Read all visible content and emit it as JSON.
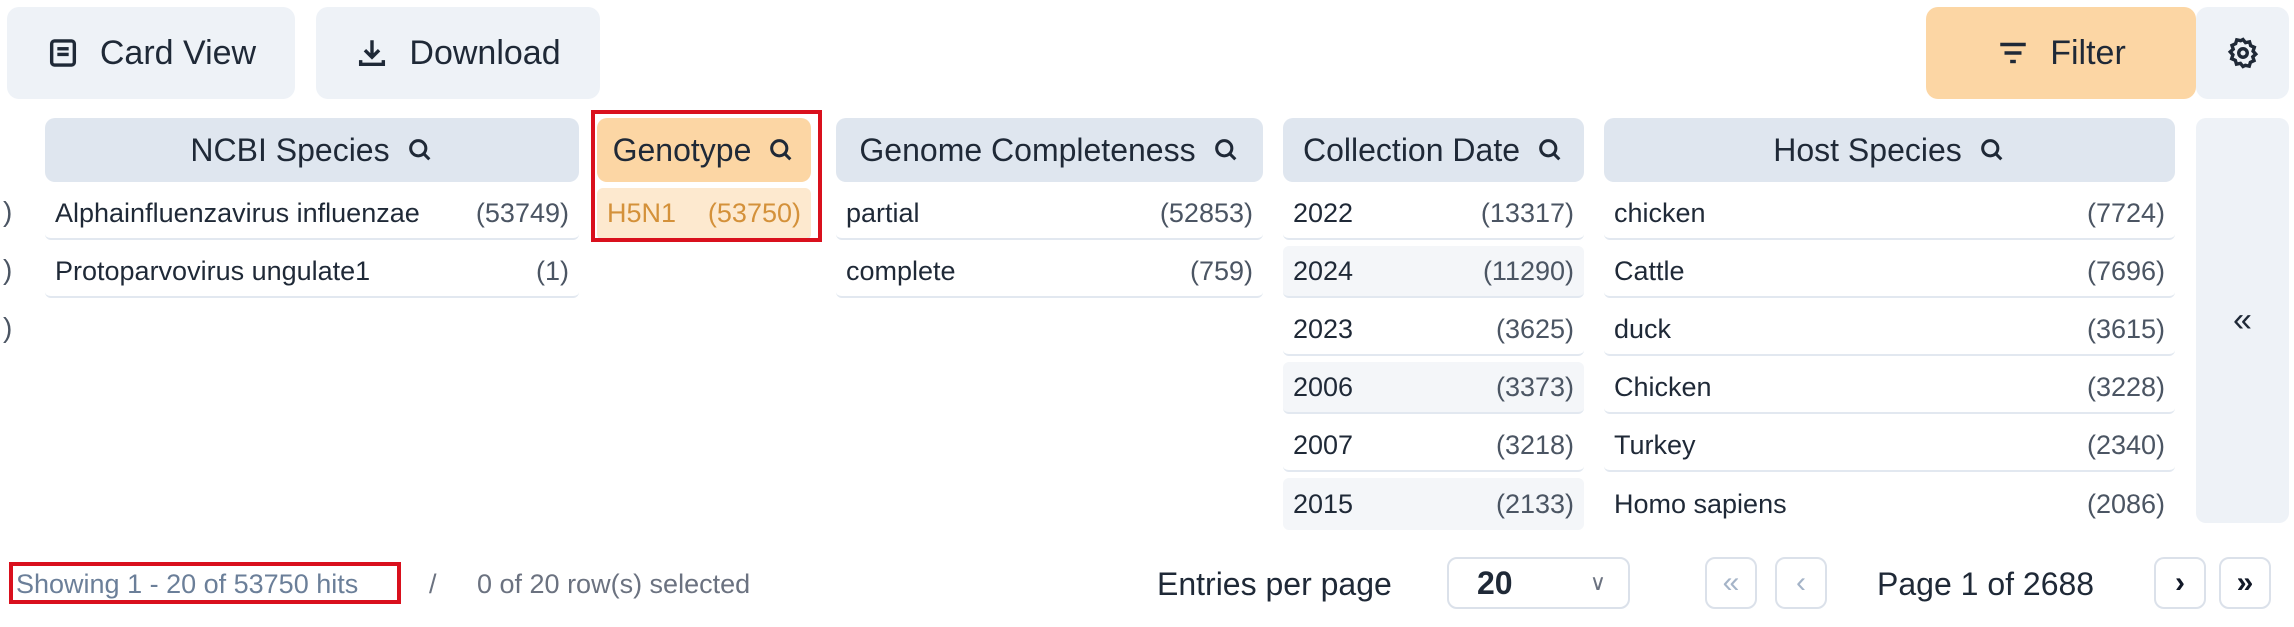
{
  "toolbar": {
    "card_view_label": "Card View",
    "download_label": "Download",
    "filter_label": "Filter"
  },
  "facets": {
    "ncbi_species": {
      "title": "NCBI Species",
      "items": [
        {
          "label": "Alphainfluenzavirus influenzae",
          "count": "(53749)"
        },
        {
          "label": "Protoparvovirus ungulate1",
          "count": "(1)"
        }
      ]
    },
    "genotype": {
      "title": "Genotype",
      "items": [
        {
          "label": "H5N1",
          "count": "(53750)",
          "selected": true
        }
      ]
    },
    "genome_completeness": {
      "title": "Genome Completeness",
      "items": [
        {
          "label": "partial",
          "count": "(52853)"
        },
        {
          "label": "complete",
          "count": "(759)"
        }
      ]
    },
    "collection_date": {
      "title": "Collection Date",
      "items": [
        {
          "label": "2022",
          "count": "(13317)"
        },
        {
          "label": "2024",
          "count": "(11290)"
        },
        {
          "label": "2023",
          "count": "(3625)"
        },
        {
          "label": "2006",
          "count": "(3373)"
        },
        {
          "label": "2007",
          "count": "(3218)"
        },
        {
          "label": "2015",
          "count": "(2133)"
        }
      ]
    },
    "host_species": {
      "title": "Host Species",
      "items": [
        {
          "label": "chicken",
          "count": "(7724)"
        },
        {
          "label": "Cattle",
          "count": "(7696)"
        },
        {
          "label": "duck",
          "count": "(3615)"
        },
        {
          "label": "Chicken",
          "count": "(3228)"
        },
        {
          "label": "Turkey",
          "count": "(2340)"
        },
        {
          "label": "Homo sapiens",
          "count": "(2086)"
        }
      ]
    },
    "left_edge_fragments": [
      ")",
      ")",
      ")"
    ]
  },
  "collapse_glyph": "«",
  "footer": {
    "showing": "Showing 1 - 20 of 53750 hits",
    "separator": "/",
    "selected": "0 of 20 row(s) selected",
    "entries_label": "Entries per page",
    "entries_value": "20",
    "page_label": "Page 1 of 2688",
    "first_glyph": "«",
    "prev_glyph": "‹",
    "next_glyph": "›",
    "last_glyph": "»"
  },
  "colors": {
    "accent": "#fcd6a4",
    "selected_text": "#d4913a",
    "highlight_border": "#d9101d",
    "header_bg": "#dfe6ef"
  },
  "icons": [
    "card-view-icon",
    "download-icon",
    "filter-icon",
    "settings-gear-icon",
    "search-icon",
    "collapse-icon"
  ]
}
